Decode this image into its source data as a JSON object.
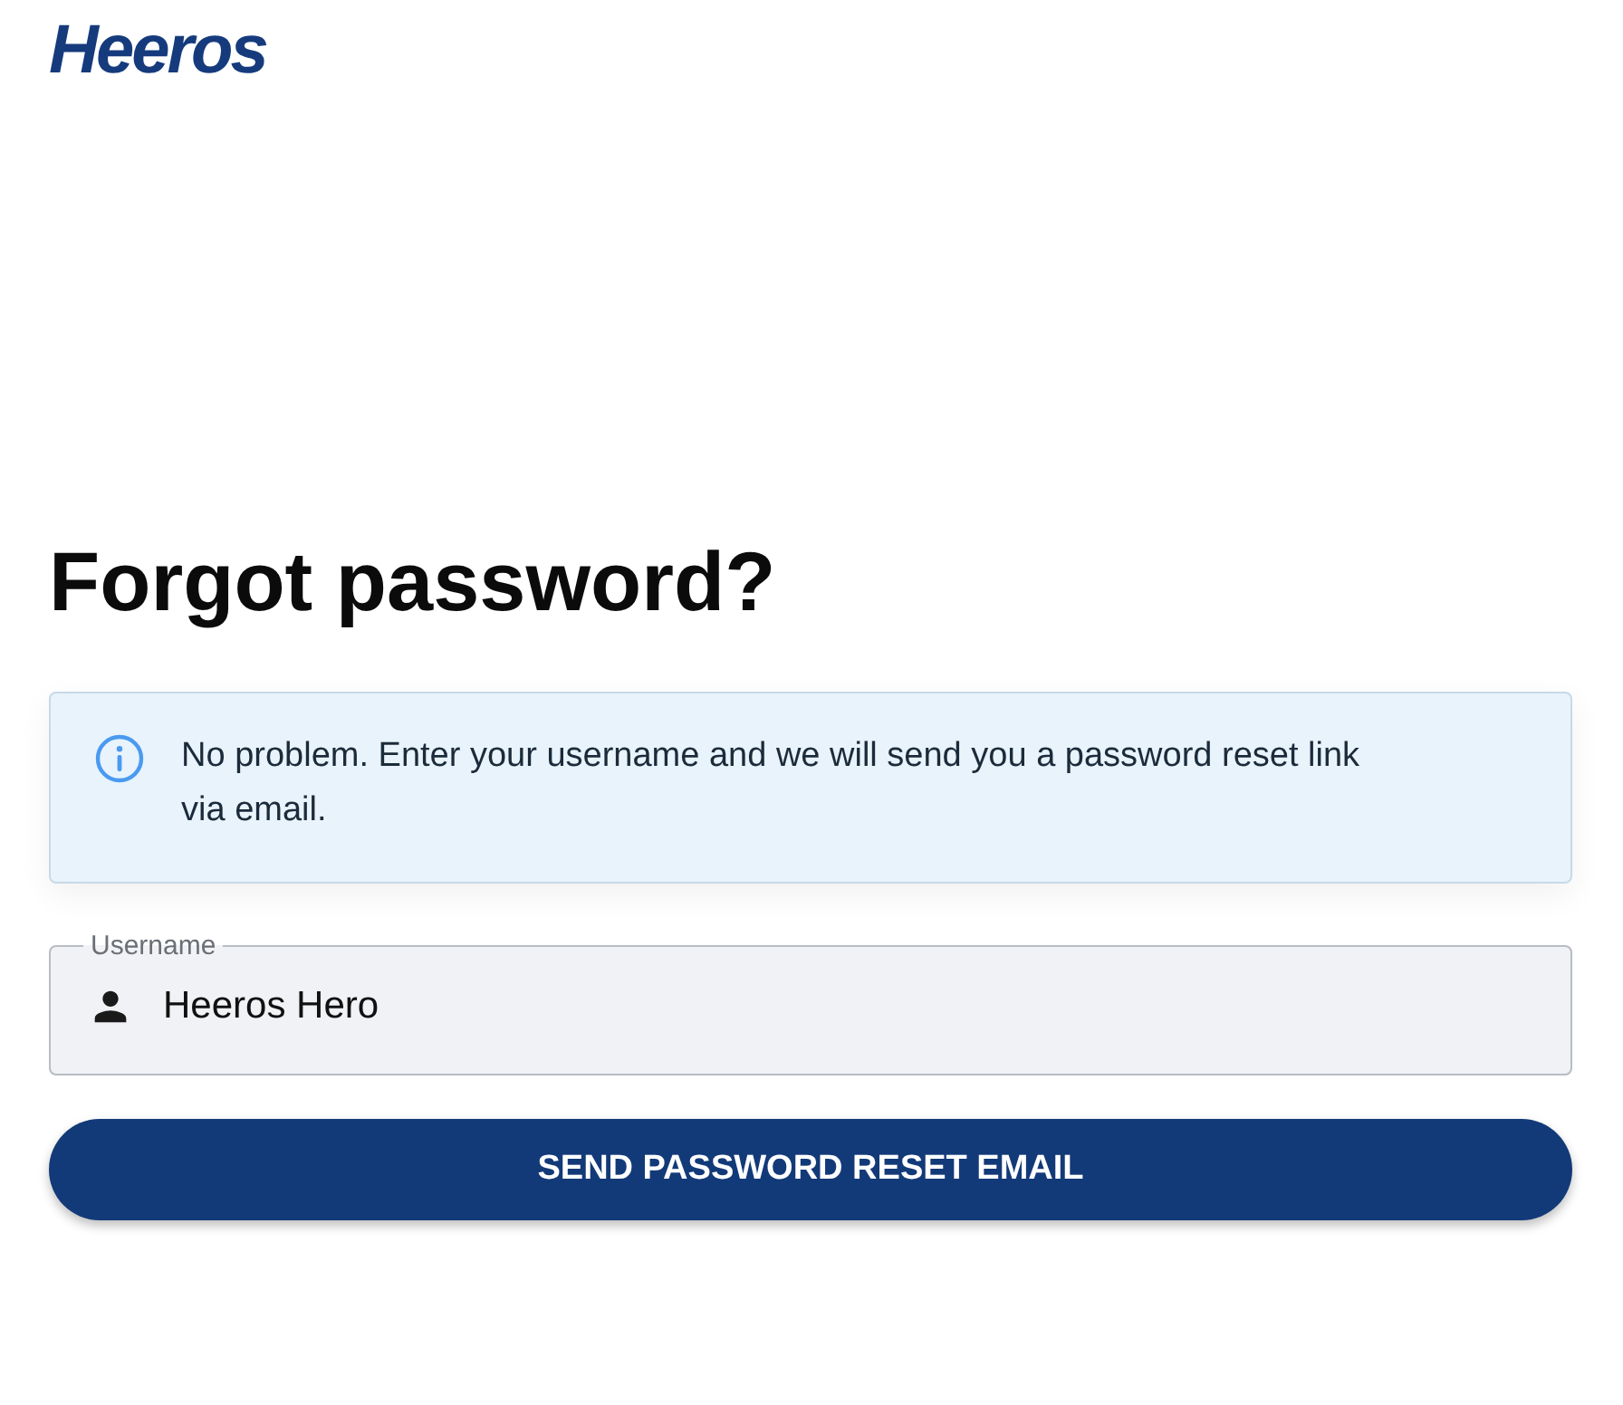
{
  "logo": {
    "text": "Heeros"
  },
  "heading": "Forgot password?",
  "info_alert": {
    "message": "No problem. Enter your username and we will send you a password reset link via email."
  },
  "username_field": {
    "label": "Username",
    "value": "Heeros Hero"
  },
  "submit_button": {
    "label": "SEND PASSWORD RESET EMAIL"
  }
}
